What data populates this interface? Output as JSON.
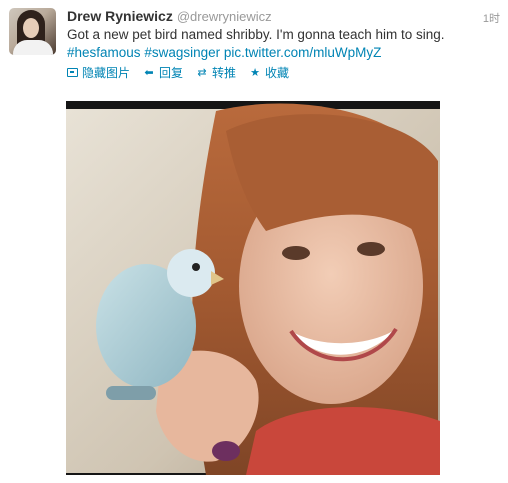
{
  "tweet": {
    "fullname": "Drew Ryniewicz",
    "username": "@drewryniewicz",
    "timestamp": "1时",
    "text_plain": "Got a new pet bird named shribby. I'm gonna teach him to sing.",
    "hashtag_1": "#hesfamous",
    "hashtag_2": "#swagsinger",
    "pic_link": "pic.twitter.com/mluWpMyZ"
  },
  "actions": {
    "hide_media": "隐藏图片",
    "reply": "回复",
    "retweet": "转推",
    "favorite": "收藏",
    "reply_icon": "reply-arrow-icon",
    "retweet_icon": "retweet-icon",
    "favorite_icon": "star-icon",
    "media_icon": "media-icon"
  },
  "colors": {
    "link": "#0084b4",
    "name": "#333333",
    "muted": "#999999"
  }
}
